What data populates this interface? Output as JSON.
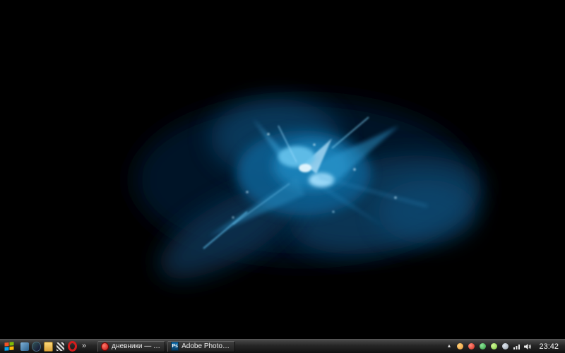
{
  "desktop": {
    "wallpaper_name": "blue-abstract-shard-explosion-on-black",
    "accent_color": "#1d85bd"
  },
  "taskbar": {
    "background_color": "#262626",
    "start": {
      "icon": "windows-logo"
    },
    "quick_launch": {
      "overflow_label": "»",
      "icons": [
        {
          "name": "media-player-icon"
        },
        {
          "name": "browser-icon"
        },
        {
          "name": "folder-icon"
        },
        {
          "name": "checkerboard-app-icon"
        },
        {
          "name": "opera-icon",
          "color": "#d21c1c"
        }
      ]
    },
    "windows": [
      {
        "label": "дневники — Le ch...",
        "icon": "diary-red-icon"
      },
      {
        "label": "Adobe Photoshop C...",
        "icon": "photoshop-icon",
        "icon_text": "Ps"
      }
    ],
    "tray": {
      "collapse_label": "▲",
      "icons": [
        {
          "name": "tray-orange-icon",
          "color": "#e8973a"
        },
        {
          "name": "tray-red-icon",
          "color": "#d22c1e"
        },
        {
          "name": "tray-green-icon",
          "color": "#2f9e3f"
        },
        {
          "name": "tray-lightgreen-icon",
          "color": "#7fce3e"
        },
        {
          "name": "tray-gray-icon",
          "color": "#9aa4b0"
        },
        {
          "name": "network-icon"
        },
        {
          "name": "volume-icon"
        }
      ],
      "clock": "23:42"
    }
  }
}
